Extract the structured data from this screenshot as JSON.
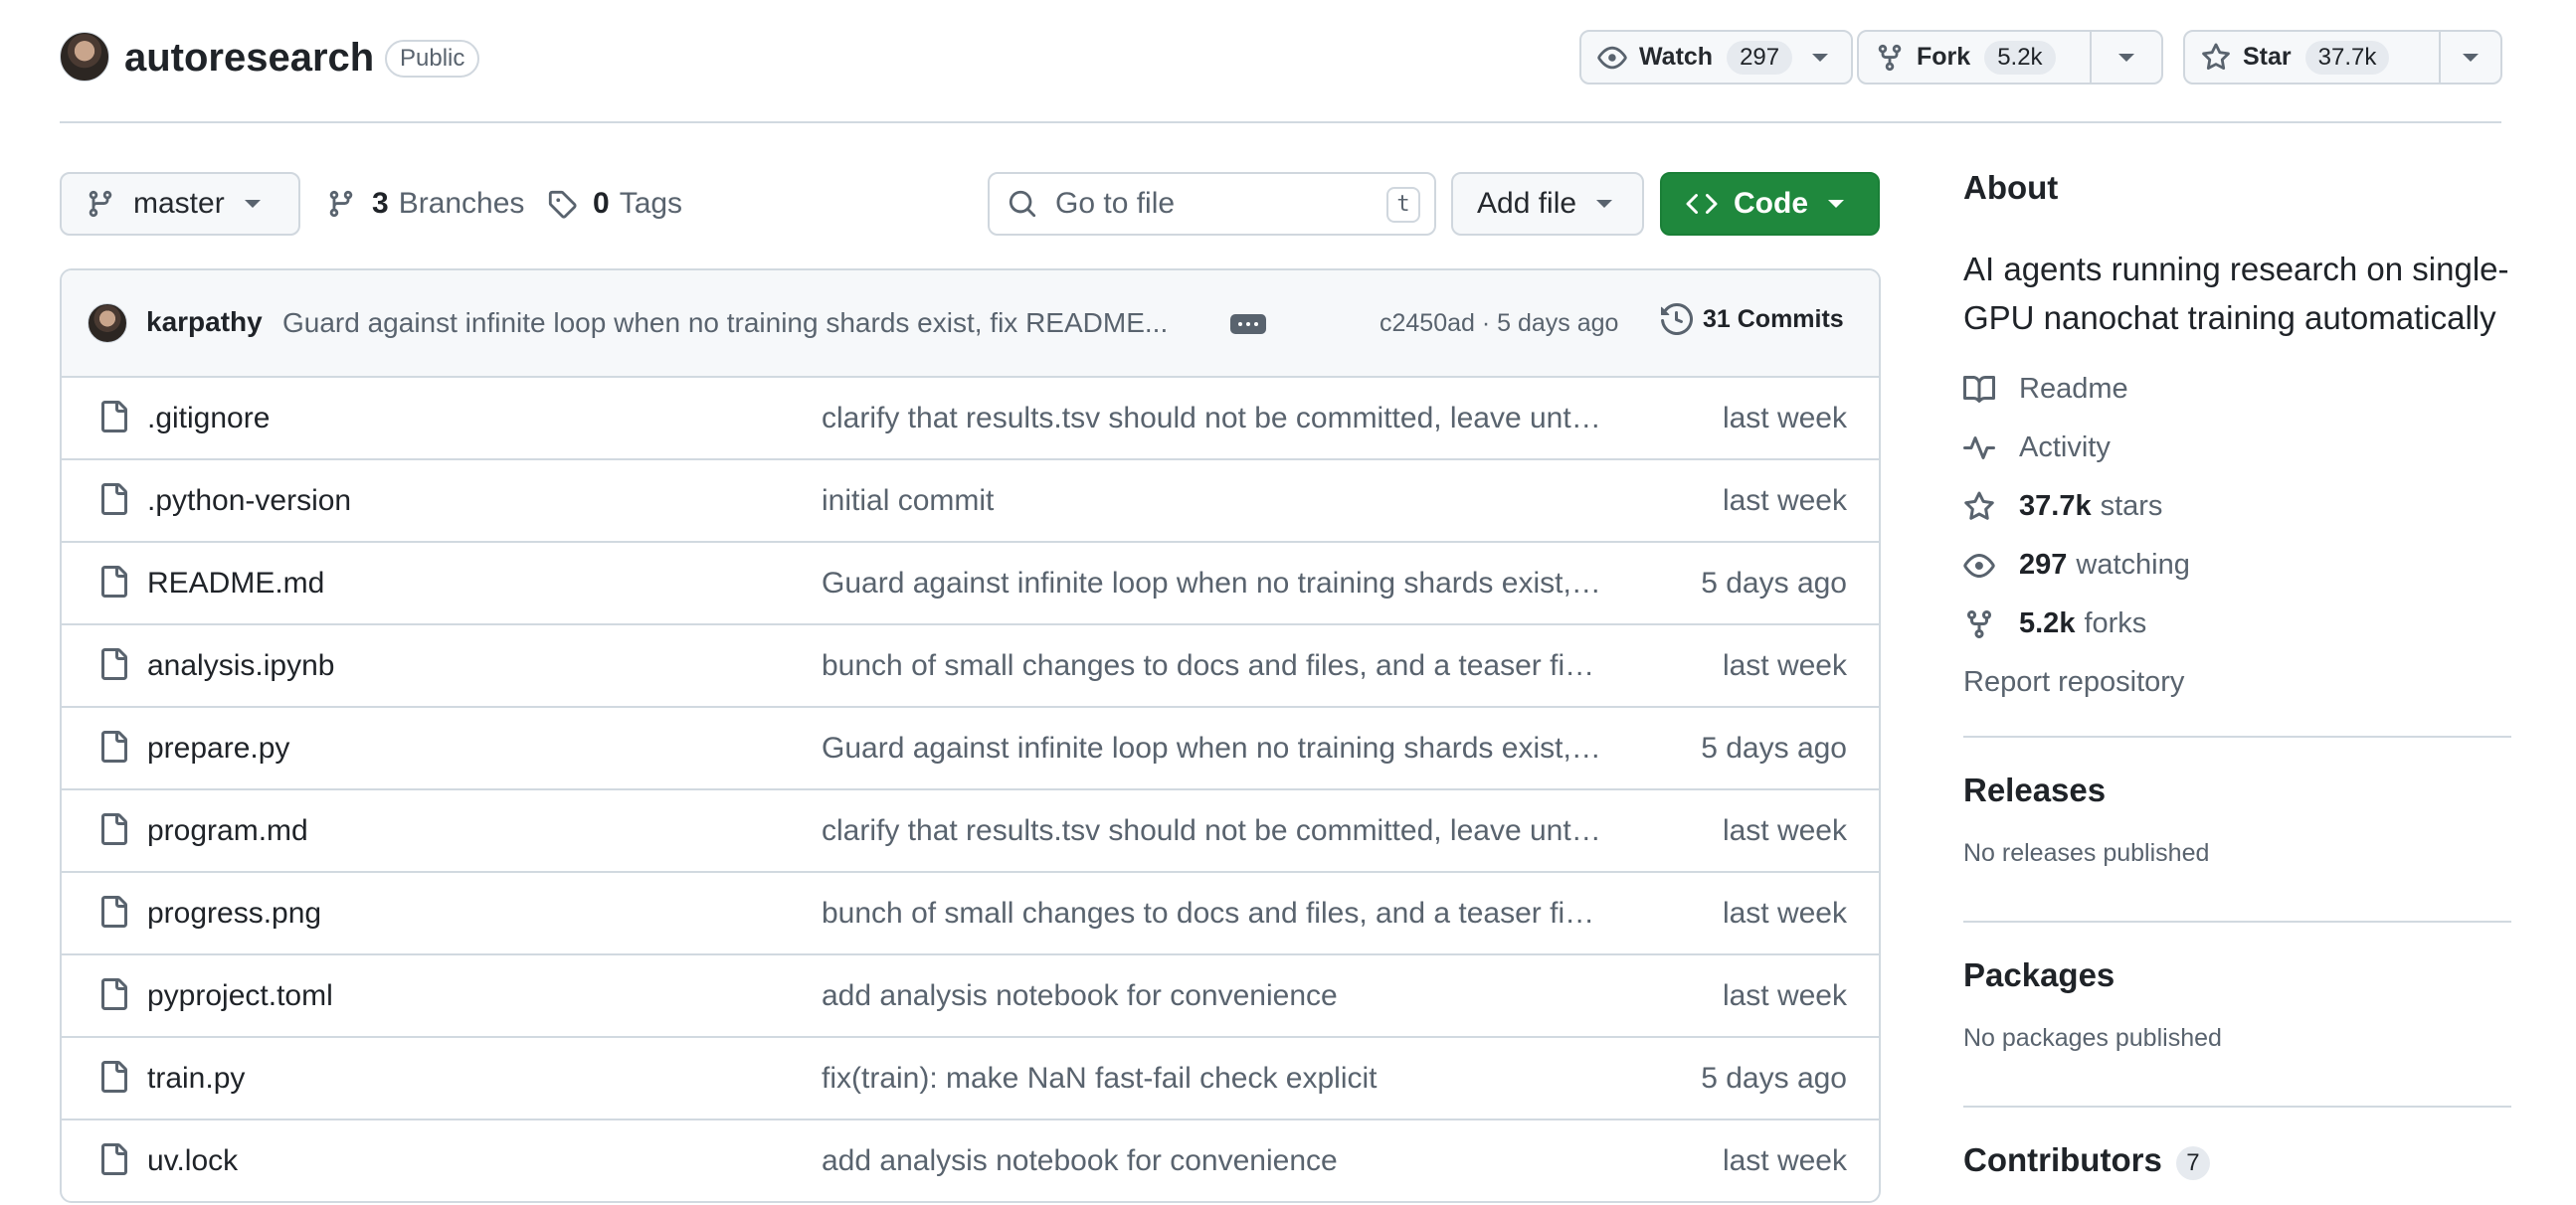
{
  "repo": {
    "name": "autoresearch",
    "visibility": "Public"
  },
  "header_actions": {
    "watch": {
      "label": "Watch",
      "count": "297"
    },
    "fork": {
      "label": "Fork",
      "count": "5.2k"
    },
    "star": {
      "label": "Star",
      "count": "37.7k"
    }
  },
  "toolbar": {
    "branch": "master",
    "branches": {
      "count": "3",
      "label": "Branches"
    },
    "tags": {
      "count": "0",
      "label": "Tags"
    },
    "search_placeholder": "Go to file",
    "search_shortcut": "t",
    "add_file": "Add file",
    "code": "Code"
  },
  "latest_commit": {
    "author": "karpathy",
    "message": "Guard against infinite loop when no training shards exist, fix README...",
    "meta": "c2450ad · 5 days ago",
    "commits_label": "31 Commits"
  },
  "files": [
    {
      "name": ".gitignore",
      "message": "clarify that results.tsv should not be committed, leave untracked",
      "date": "last week"
    },
    {
      "name": ".python-version",
      "message": "initial commit",
      "date": "last week"
    },
    {
      "name": "README.md",
      "message": "Guard against infinite loop when no training shards exist, fix README",
      "date": "5 days ago"
    },
    {
      "name": "analysis.ipynb",
      "message": "bunch of small changes to docs and files, and a teaser figure",
      "date": "last week"
    },
    {
      "name": "prepare.py",
      "message": "Guard against infinite loop when no training shards exist, fix README",
      "date": "5 days ago"
    },
    {
      "name": "program.md",
      "message": "clarify that results.tsv should not be committed, leave untracked",
      "date": "last week"
    },
    {
      "name": "progress.png",
      "message": "bunch of small changes to docs and files, and a teaser figure",
      "date": "last week"
    },
    {
      "name": "pyproject.toml",
      "message": "add analysis notebook for convenience",
      "date": "last week"
    },
    {
      "name": "train.py",
      "message": "fix(train): make NaN fast-fail check explicit",
      "date": "5 days ago"
    },
    {
      "name": "uv.lock",
      "message": "add analysis notebook for convenience",
      "date": "last week"
    }
  ],
  "about": {
    "heading": "About",
    "description": "AI agents running research on single-GPU nanochat training automatically",
    "readme": "Readme",
    "activity": "Activity",
    "stars_count": "37.7k",
    "stars_label": "stars",
    "watching_count": "297",
    "watching_label": "watching",
    "forks_count": "5.2k",
    "forks_label": "forks",
    "report": "Report repository"
  },
  "releases": {
    "heading": "Releases",
    "note": "No releases published"
  },
  "packages": {
    "heading": "Packages",
    "note": "No packages published"
  },
  "contributors": {
    "heading": "Contributors",
    "count": "7"
  },
  "colors": {
    "accent_green": "#1f883d",
    "muted_text": "#59636e",
    "border": "#d1d9e0"
  }
}
